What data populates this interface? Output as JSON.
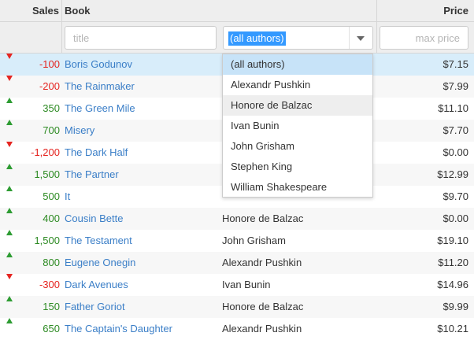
{
  "header": {
    "sales": "Sales",
    "book": "Book",
    "price": "Price"
  },
  "filters": {
    "title_placeholder": "title",
    "author_selected": "(all authors)",
    "price_placeholder": "max price"
  },
  "author_options": [
    "(all authors)",
    "Alexandr Pushkin",
    "Honore de Balzac",
    "Ivan Bunin",
    "John Grisham",
    "Stephen King",
    "William Shakespeare"
  ],
  "rows": [
    {
      "sales": "-100",
      "trend": "down",
      "book": "Boris Godunov",
      "author": "",
      "price": "$7.15"
    },
    {
      "sales": "-200",
      "trend": "down",
      "book": "The Rainmaker",
      "author": "",
      "price": "$7.99"
    },
    {
      "sales": "350",
      "trend": "up",
      "book": "The Green Mile",
      "author": "",
      "price": "$11.10"
    },
    {
      "sales": "700",
      "trend": "up",
      "book": "Misery",
      "author": "",
      "price": "$7.70"
    },
    {
      "sales": "-1,200",
      "trend": "down",
      "book": "The Dark Half",
      "author": "",
      "price": "$0.00"
    },
    {
      "sales": "1,500",
      "trend": "up",
      "book": "The Partner",
      "author": "",
      "price": "$12.99"
    },
    {
      "sales": "500",
      "trend": "up",
      "book": "It",
      "author": "",
      "price": "$9.70"
    },
    {
      "sales": "400",
      "trend": "up",
      "book": "Cousin Bette",
      "author": "Honore de Balzac",
      "price": "$0.00"
    },
    {
      "sales": "1,500",
      "trend": "up",
      "book": "The Testament",
      "author": "John Grisham",
      "price": "$19.10"
    },
    {
      "sales": "800",
      "trend": "up",
      "book": "Eugene Onegin",
      "author": "Alexandr Pushkin",
      "price": "$11.20"
    },
    {
      "sales": "-300",
      "trend": "down",
      "book": "Dark Avenues",
      "author": "Ivan Bunin",
      "price": "$14.96"
    },
    {
      "sales": "150",
      "trend": "up",
      "book": "Father Goriot",
      "author": "Honore de Balzac",
      "price": "$9.99"
    },
    {
      "sales": "650",
      "trend": "up",
      "book": "The Captain's Daughter",
      "author": "Alexandr Pushkin",
      "price": "$10.21"
    }
  ],
  "colors": {
    "positive": "#2e8b24",
    "negative": "#e52521",
    "link": "#3a7ec7",
    "selected_row": "#d8edfa"
  }
}
